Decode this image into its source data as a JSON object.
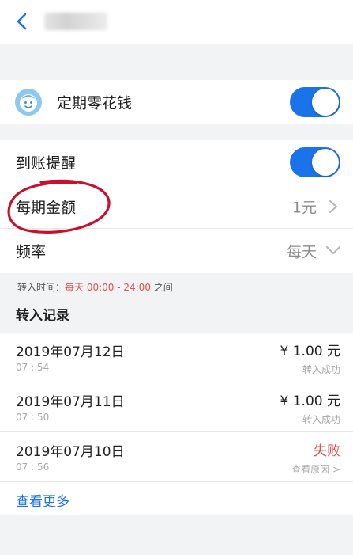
{
  "nav": {
    "back_icon": "chevron-left-icon"
  },
  "plan": {
    "title": "定期零花钱",
    "toggle_on": true,
    "icon": "smiley-face-icon"
  },
  "settings": {
    "reminder_label": "到账提醒",
    "reminder_on": true,
    "amount_label": "每期金额",
    "amount_value": "1元",
    "frequency_label": "频率",
    "frequency_value": "每天"
  },
  "transfer_time": {
    "prefix": "转入时间：",
    "highlight": "每天 00:00 - 24:00",
    "suffix": " 之间"
  },
  "records": {
    "title": "转入记录",
    "items": [
      {
        "date": "2019年07月12日",
        "time": "07 : 54",
        "amount": "¥ 1.00 元",
        "status": "转入成功",
        "failed": false
      },
      {
        "date": "2019年07月11日",
        "time": "07 : 50",
        "amount": "¥ 1.00 元",
        "status": "转入成功",
        "failed": false
      },
      {
        "date": "2019年07月10日",
        "time": "07 : 56",
        "amount": "失败",
        "status": "查看原因 >",
        "failed": true
      }
    ],
    "more": "查看更多"
  },
  "colors": {
    "accent": "#1a73e8",
    "error": "#d9534f",
    "annotation": "#c8102e"
  }
}
